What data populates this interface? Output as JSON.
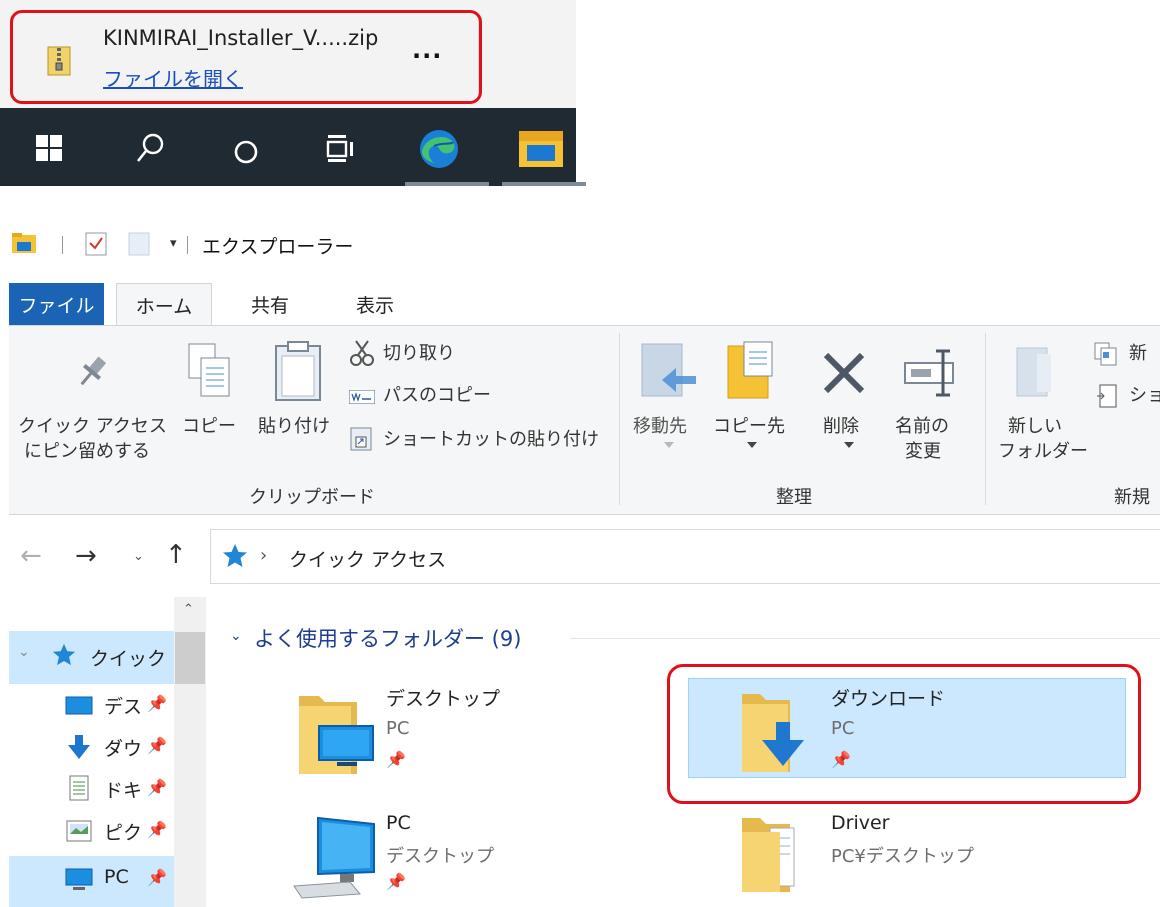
{
  "download": {
    "filename": "KINMIRAI_Installer_V.....zip",
    "open_link": "ファイルを開く",
    "more": "..."
  },
  "taskbar": {
    "items": [
      "windows-start-icon",
      "search-icon",
      "cortana-icon",
      "task-view-icon",
      "edge-icon",
      "file-explorer-icon"
    ]
  },
  "explorer": {
    "title": "エクスプローラー",
    "tabs": {
      "file": "ファイル",
      "home": "ホーム",
      "share": "共有",
      "view": "表示"
    },
    "ribbon": {
      "pin_line1": "クイック アクセス",
      "pin_line2": "にピン留めする",
      "copy": "コピー",
      "paste": "貼り付け",
      "cut": "切り取り",
      "copy_path": "パスのコピー",
      "paste_shortcut": "ショートカットの貼り付け",
      "group_clipboard": "クリップボード",
      "move_to": "移動先",
      "copy_to": "コピー先",
      "delete": "削除",
      "rename_line1": "名前の",
      "rename_line2": "変更",
      "group_organize": "整理",
      "new_folder_line1": "新しい",
      "new_folder_line2": "フォルダー",
      "new_item_partial": "新",
      "shortcut_partial": "ショ",
      "group_new": "新規"
    },
    "address": {
      "location": "クイック アクセス",
      "separator": "›"
    },
    "nav_pane": {
      "quick_access": "クイック ア",
      "items": [
        "デス",
        "ダウ",
        "ドキ:",
        "ピク",
        "PC"
      ]
    },
    "content": {
      "section_title": "よく使用するフォルダー (9)",
      "tiles": [
        {
          "name": "デスクトップ",
          "location": "PC"
        },
        {
          "name": "ダウンロード",
          "location": "PC"
        },
        {
          "name": "PC",
          "location": "デスクトップ"
        },
        {
          "name": "Driver",
          "location": "PC¥デスクトップ"
        }
      ]
    }
  },
  "colors": {
    "highlight_red": "#e0101a",
    "file_tab_blue": "#1b63b5",
    "selection_blue": "#cce8ff",
    "taskbar": "#202a32",
    "link_blue": "#1a4fbd"
  }
}
